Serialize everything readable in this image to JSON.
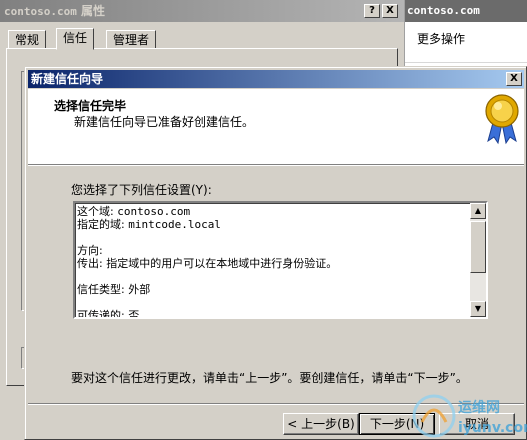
{
  "background_window": {
    "title_domain": "contoso.com",
    "title_suffix": " 属性",
    "help_btn": "?",
    "close_btn": "X",
    "tabs": [
      {
        "label": "常规"
      },
      {
        "label": "信任"
      },
      {
        "label": "管理者"
      }
    ]
  },
  "right_panel": {
    "header": "contoso.com",
    "more_actions": "更多操作"
  },
  "wizard": {
    "title": "新建信任向导",
    "close_btn": "X",
    "heading": "选择信任完毕",
    "subheading": "新建信任向导已准备好创建信任。",
    "selection_label": "您选择了下列信任设置(Y):",
    "settings_lines": [
      {
        "label": "这个域:",
        "value": "contoso.com"
      },
      {
        "label": "指定的域:",
        "value": "mintcode.local"
      },
      {
        "label": "",
        "value": ""
      },
      {
        "label": "方向:",
        "value": ""
      },
      {
        "label": "传出:",
        "value": "指定域中的用户可以在本地域中进行身份验证。"
      },
      {
        "label": "",
        "value": ""
      },
      {
        "label": "信任类型:",
        "value": "外部"
      },
      {
        "label": "",
        "value": ""
      },
      {
        "label": "可传递的:",
        "value": "否"
      }
    ],
    "bottom_note": "要对这个信任进行更改，请单击“上一步”。要创建信任，请单击“下一步”。",
    "buttons": {
      "back": "< 上一步(B)",
      "next": "下一步(N)",
      "cancel": "取消"
    }
  },
  "watermark": {
    "text": "运维网",
    "domain": "iyunv.com"
  },
  "colors": {
    "wizard_title_start": "#0a246a",
    "wizard_title_end": "#a6caf0",
    "dialog_face": "#d4d0c8"
  }
}
